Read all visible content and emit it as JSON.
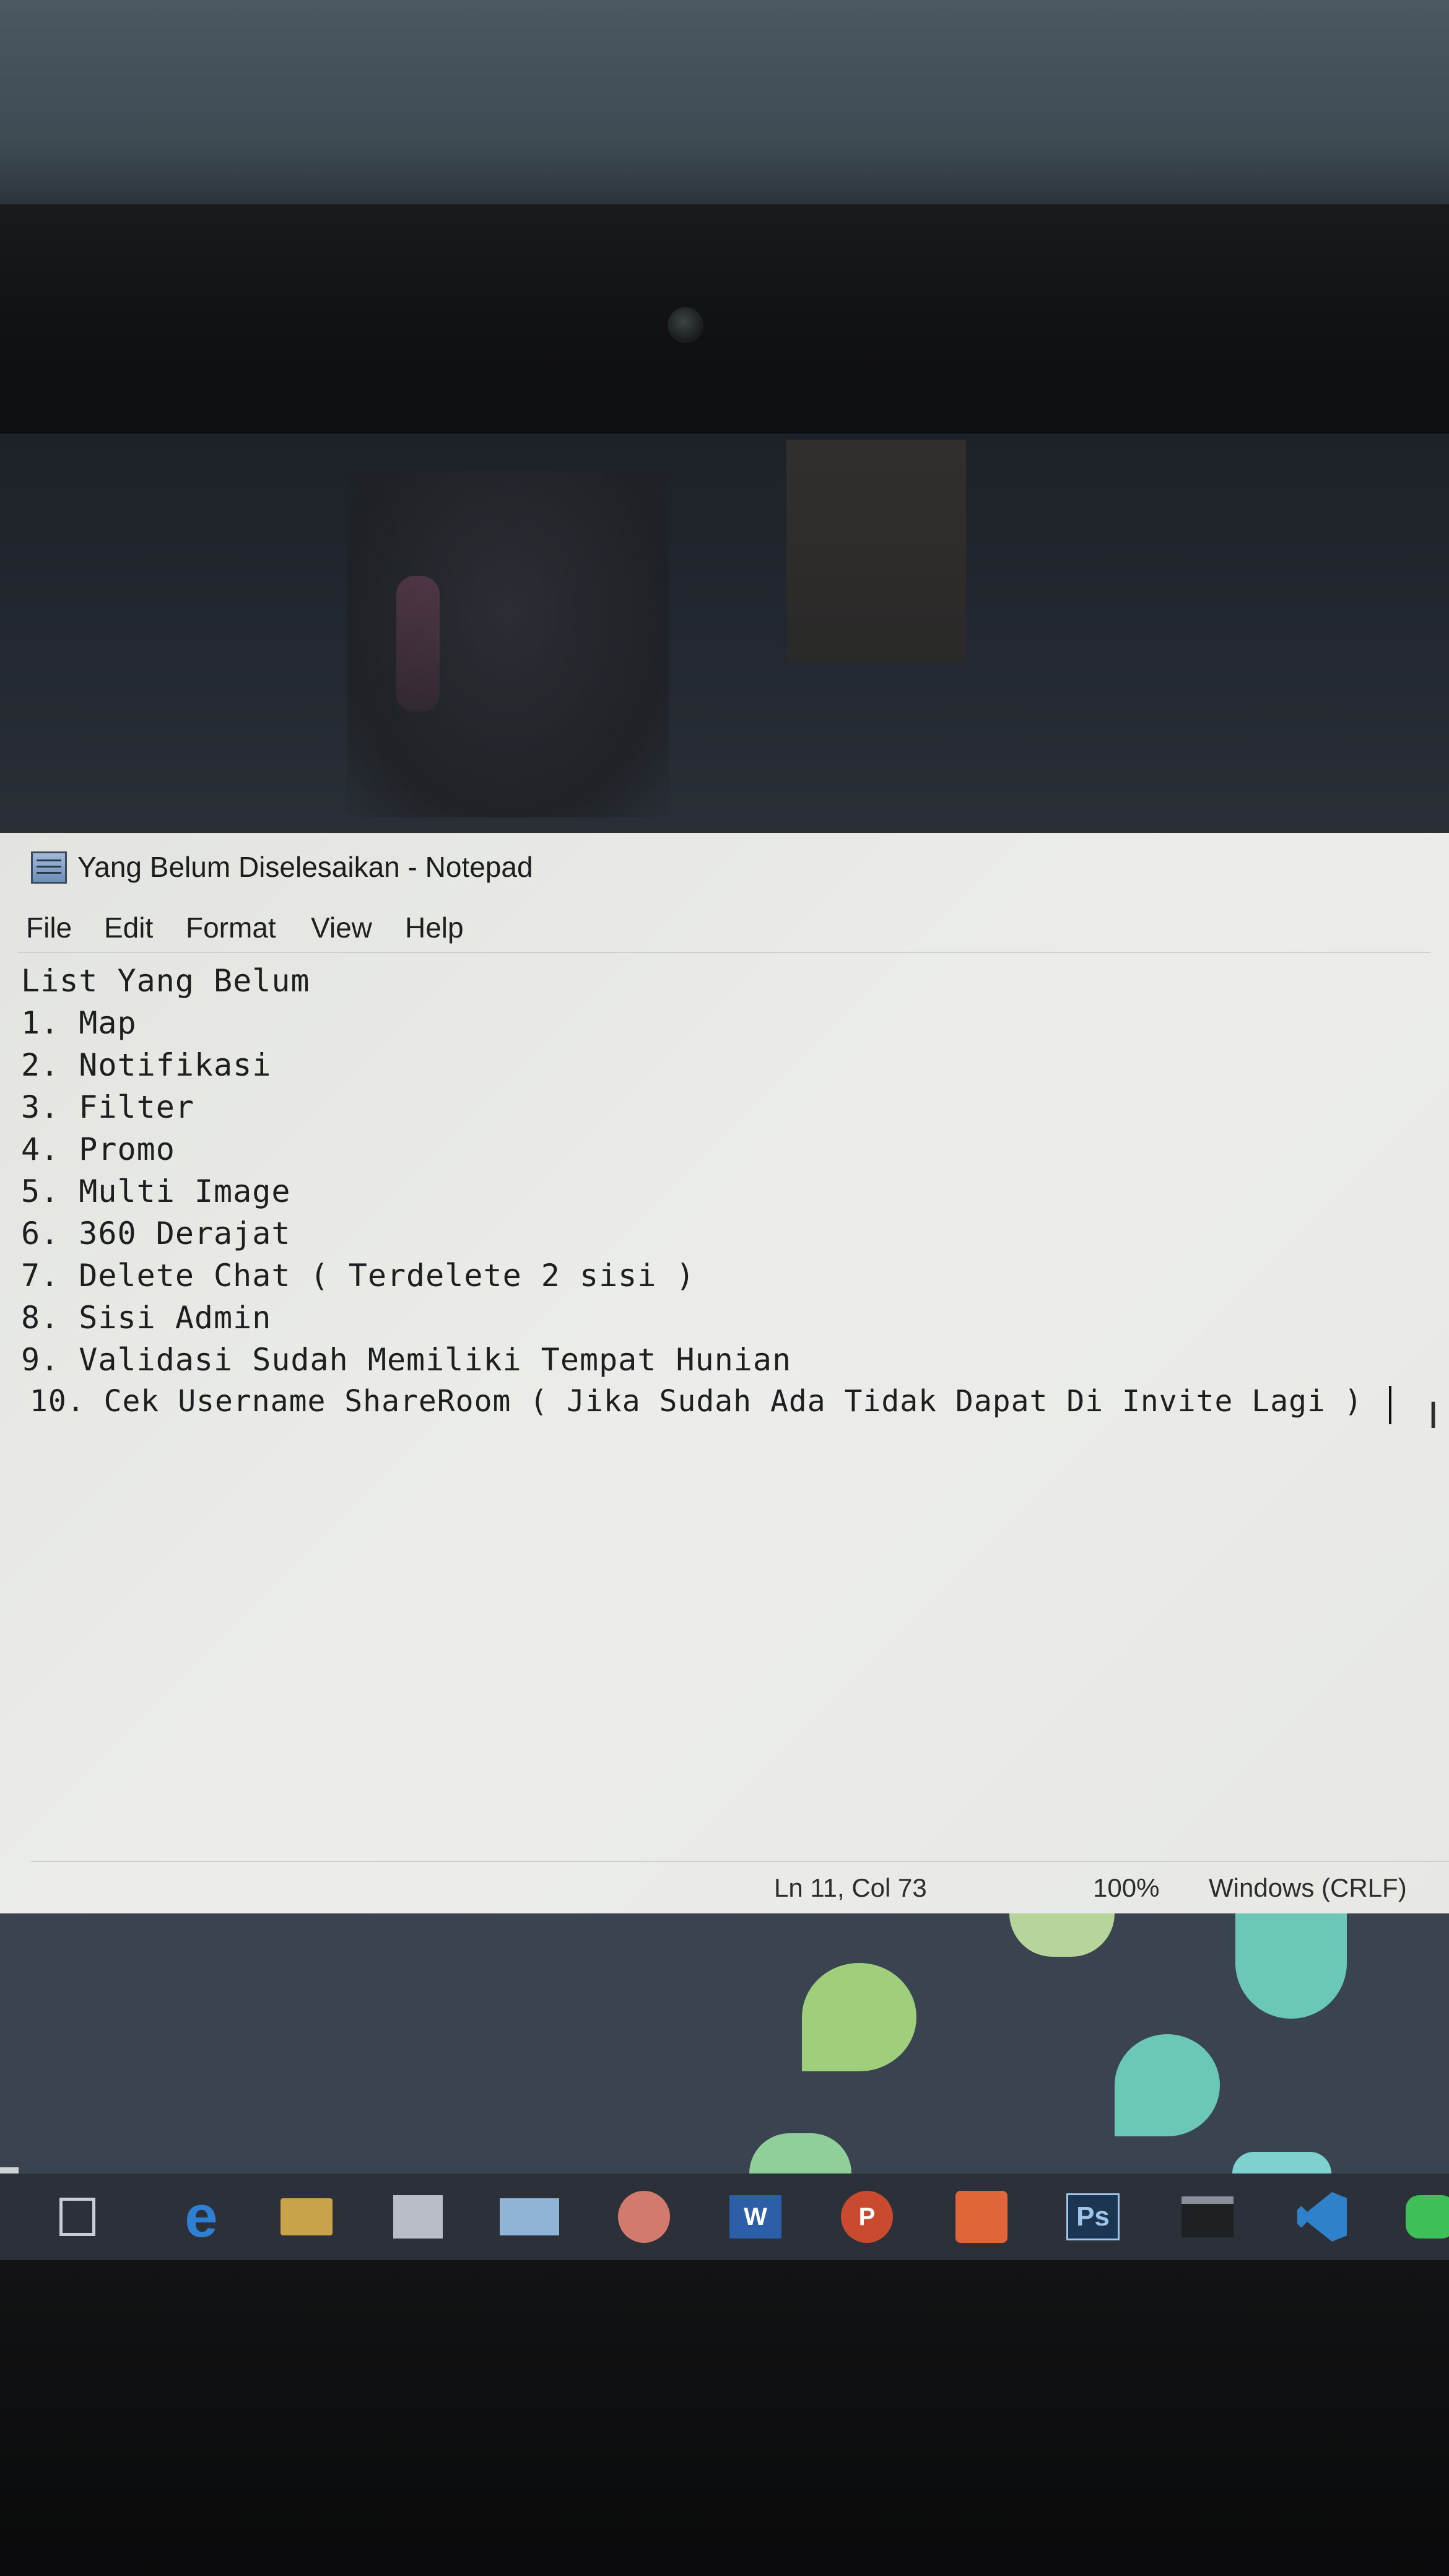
{
  "window": {
    "title": "Yang Belum Diselesaikan - Notepad"
  },
  "menu": {
    "items": [
      {
        "label": "File"
      },
      {
        "label": "Edit"
      },
      {
        "label": "Format"
      },
      {
        "label": "View"
      },
      {
        "label": "Help"
      }
    ]
  },
  "editor": {
    "lines": [
      "List Yang Belum",
      "1. Map",
      "2. Notifikasi",
      "3. Filter",
      "4. Promo",
      "5. Multi Image",
      "6. 360 Derajat",
      "7. Delete Chat ( Terdelete 2 sisi )",
      "8. Sisi Admin",
      "9. Validasi Sudah Memiliki Tempat Hunian",
      "10. Cek Username ShareRoom ( Jika Sudah Ada Tidak Dapat Di Invite Lagi )"
    ]
  },
  "status_bar": {
    "position": "Ln 11, Col 73",
    "zoom": "100%",
    "line_ending": "Windows (CRLF)"
  },
  "taskbar": {
    "items": [
      {
        "icon": "task-view-icon",
        "label": "",
        "color": "#c9ced6"
      },
      {
        "icon": "edge-icon",
        "label": "e",
        "color": "#2f7fd3"
      },
      {
        "icon": "file-explorer-icon",
        "label": "",
        "color": "#c9a34a"
      },
      {
        "icon": "store-icon",
        "label": "",
        "color": "#c9ced6"
      },
      {
        "icon": "mail-icon",
        "label": "",
        "color": "#4d8fcf"
      },
      {
        "icon": "chrome-icon",
        "label": "",
        "color": "#d24a3a"
      },
      {
        "icon": "word-icon",
        "label": "W",
        "color": "#2d5fa8"
      },
      {
        "icon": "powerpoint-icon",
        "label": "P",
        "color": "#c94a2e"
      },
      {
        "icon": "xampp-icon",
        "label": "",
        "color": "#e0663a"
      },
      {
        "icon": "photoshop-icon",
        "label": "Ps",
        "color": "#1c3552"
      },
      {
        "icon": "terminal-icon",
        "label": "",
        "color": "#5b6068"
      },
      {
        "icon": "vscode-icon",
        "label": "",
        "color": "#2f82c9"
      },
      {
        "icon": "line-icon",
        "label": "",
        "color": "#3fbf57"
      }
    ]
  },
  "colors": {
    "notepad_bg": "#e7e8e4",
    "desktop_bg": "#3a4350",
    "taskbar_bg": "#2c3139"
  }
}
